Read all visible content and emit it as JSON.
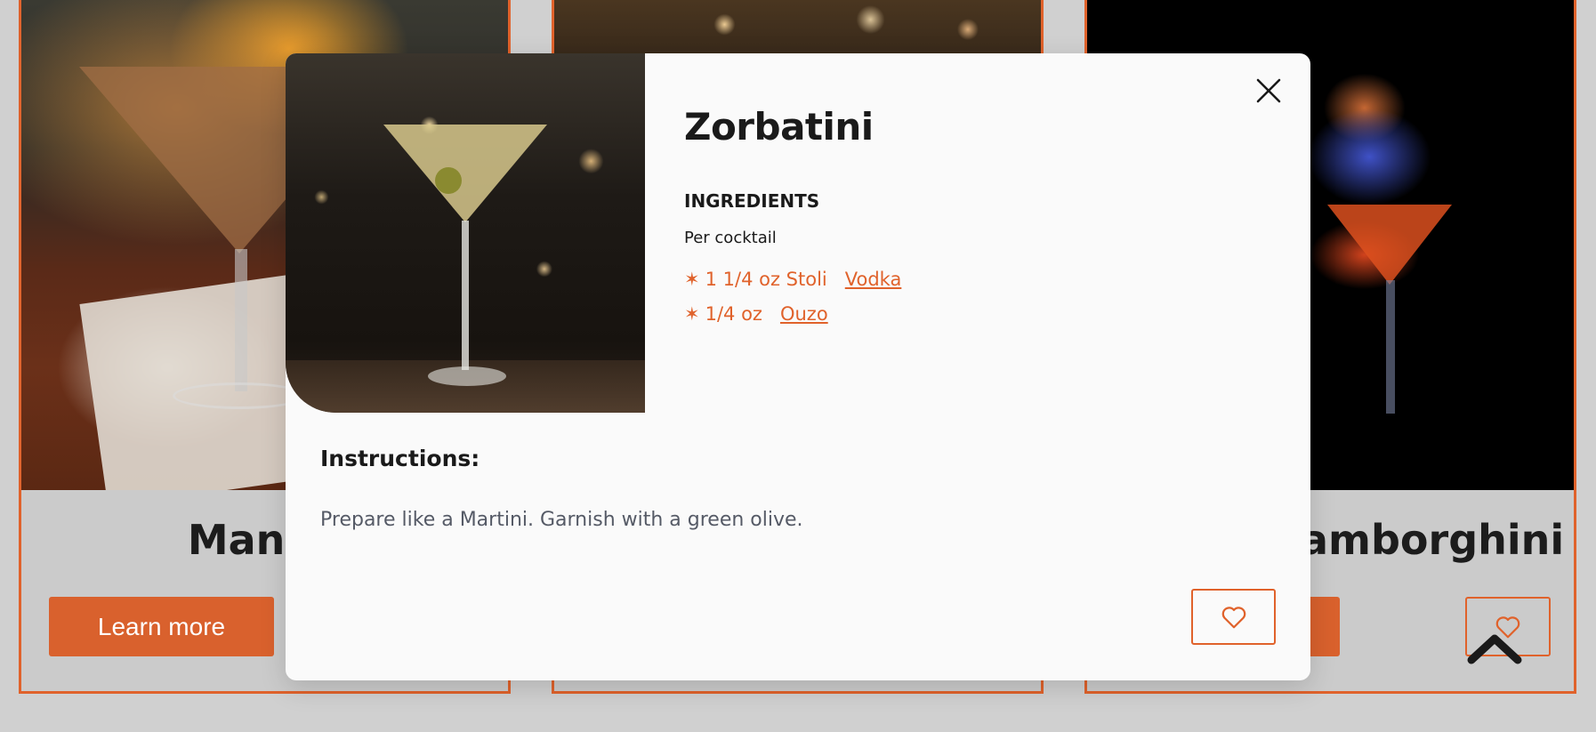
{
  "cards": [
    {
      "title": "Manha",
      "button_label": "Learn more",
      "favorite_icon": "heart-icon"
    },
    {
      "title": "",
      "button_label": "",
      "favorite_icon": "heart-icon"
    },
    {
      "title": "amborghini",
      "button_label": "",
      "favorite_icon": "heart-icon"
    }
  ],
  "modal": {
    "title": "Zorbatini",
    "ingredients_heading": "INGREDIENTS",
    "per_label": "Per cocktail",
    "ingredients": [
      {
        "bullet": "✶",
        "amount": "1 1/4 oz Stoli",
        "link_label": "Vodka"
      },
      {
        "bullet": "✶",
        "amount": "1/4 oz",
        "link_label": "Ouzo"
      }
    ],
    "instructions_heading": "Instructions:",
    "instructions_text": "Prepare like a Martini. Garnish with a green olive.",
    "close_icon": "close-icon",
    "favorite_icon": "heart-icon"
  },
  "scroll_top_icon": "chevron-up-icon",
  "colors": {
    "accent": "#e0622b",
    "button_fill": "#d9612d",
    "overlay_background": "#d0d0d0",
    "modal_background": "#fafafa",
    "instructions_text": "#555a66"
  }
}
